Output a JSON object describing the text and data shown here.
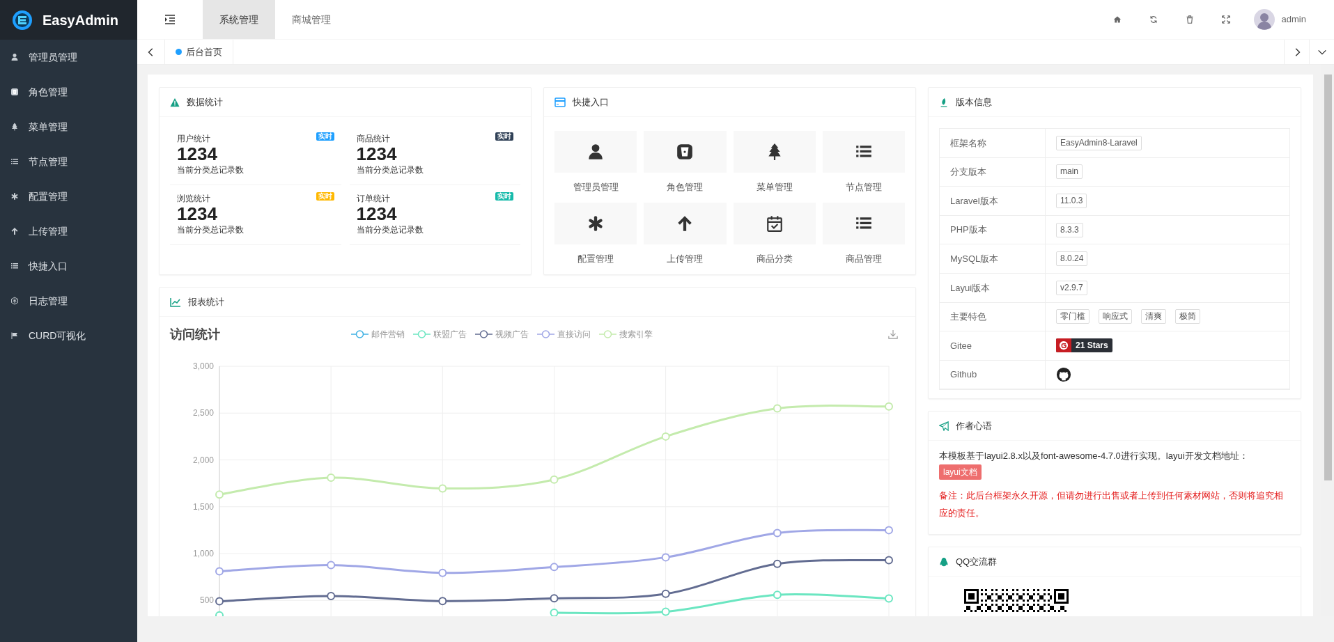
{
  "sidebar": {
    "brand": "EasyAdmin",
    "items": [
      {
        "label": "管理员管理"
      },
      {
        "label": "角色管理"
      },
      {
        "label": "菜单管理"
      },
      {
        "label": "节点管理"
      },
      {
        "label": "配置管理"
      },
      {
        "label": "上传管理"
      },
      {
        "label": "快捷入口"
      },
      {
        "label": "日志管理"
      },
      {
        "label": "CURD可视化"
      }
    ]
  },
  "header": {
    "tabs": [
      {
        "label": "系统管理",
        "selected": true
      },
      {
        "label": "商城管理",
        "selected": false
      }
    ],
    "user": "admin"
  },
  "page_tabs": [
    {
      "label": "后台首页",
      "selected": true
    }
  ],
  "stats": {
    "title": "数据统计",
    "items": [
      {
        "label": "用户统计",
        "value": "1234",
        "note": "当前分类总记录数",
        "badge": "实时",
        "color": "#1e9fff"
      },
      {
        "label": "商品统计",
        "value": "1234",
        "note": "当前分类总记录数",
        "badge": "实时",
        "color": "#2f4056"
      },
      {
        "label": "浏览统计",
        "value": "1234",
        "note": "当前分类总记录数",
        "badge": "实时",
        "color": "#ffb800"
      },
      {
        "label": "订单统计",
        "value": "1234",
        "note": "当前分类总记录数",
        "badge": "实时",
        "color": "#16baaa"
      }
    ]
  },
  "shortcuts": {
    "title": "快捷入口",
    "items": [
      "管理员管理",
      "角色管理",
      "菜单管理",
      "节点管理",
      "配置管理",
      "上传管理",
      "商品分类",
      "商品管理"
    ]
  },
  "report": {
    "title": "报表统计",
    "chart_data": {
      "type": "line",
      "title": "访问统计",
      "grid": true,
      "legend": true,
      "ylim": [
        330,
        3000
      ],
      "yticks": [
        {
          "value": 500,
          "label": "500"
        },
        {
          "value": 1000,
          "label": "1,000"
        },
        {
          "value": 1500,
          "label": "1,500"
        },
        {
          "value": 2000,
          "label": "2,000"
        },
        {
          "value": 2500,
          "label": "2,500"
        },
        {
          "value": 3000,
          "label": "3,000"
        }
      ],
      "series": [
        {
          "name": "邮件营销",
          "color": "#3fb1e3",
          "marker": "circle",
          "values": [
            null,
            null,
            null,
            null,
            null,
            null,
            null
          ]
        },
        {
          "name": "联盟广告",
          "color": "#6be6c1",
          "marker": "circle",
          "values": [
            340,
            null,
            null,
            368,
            380,
            560,
            520
          ]
        },
        {
          "name": "视频广告",
          "color": "#626c91",
          "marker": "circle",
          "values": [
            490,
            546,
            493,
            522,
            570,
            890,
            930
          ]
        },
        {
          "name": "直接访问",
          "color": "#a0a7e6",
          "marker": "circle",
          "values": [
            810,
            878,
            794,
            856,
            960,
            1220,
            1250
          ]
        },
        {
          "name": "搜索引擎",
          "color": "#c4ebad",
          "marker": "circle",
          "values": [
            1630,
            1810,
            1695,
            1790,
            2250,
            2550,
            2570
          ]
        }
      ]
    }
  },
  "version": {
    "title": "版本信息",
    "rows": [
      {
        "label": "框架名称",
        "kind": "tags",
        "tags": [
          "EasyAdmin8-Laravel"
        ]
      },
      {
        "label": "分支版本",
        "kind": "tags",
        "tags": [
          "main"
        ]
      },
      {
        "label": "Laravel版本",
        "kind": "tags",
        "tags": [
          "11.0.3"
        ]
      },
      {
        "label": "PHP版本",
        "kind": "tags",
        "tags": [
          "8.3.3"
        ]
      },
      {
        "label": "MySQL版本",
        "kind": "tags",
        "tags": [
          "8.0.24"
        ]
      },
      {
        "label": "Layui版本",
        "kind": "tags",
        "tags": [
          "v2.9.7"
        ]
      },
      {
        "label": "主要特色",
        "kind": "tags",
        "tags": [
          "零门槛",
          "响应式",
          "清爽",
          "极简"
        ]
      },
      {
        "label": "Gitee",
        "kind": "gitee",
        "badge": "21 Stars"
      },
      {
        "label": "Github",
        "kind": "github"
      }
    ]
  },
  "author": {
    "title": "作者心语",
    "text": "本模板基于layui2.8.x以及font-awesome-4.7.0进行实现。layui开发文档地址：",
    "link": "layui文档",
    "note": "备注：此后台框架永久开源，但请勿进行出售或者上传到任何素材网站，否则将追究相应的责任。"
  },
  "qq": {
    "title": "QQ交流群"
  }
}
